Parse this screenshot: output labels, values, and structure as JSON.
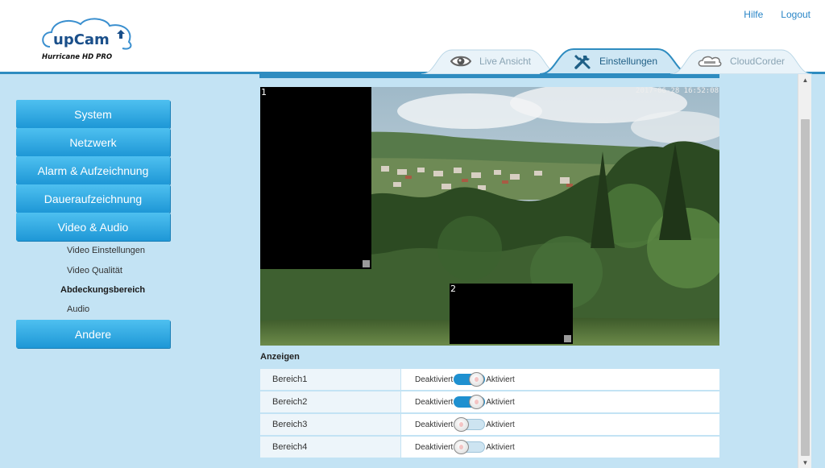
{
  "brand": {
    "logo_text": "upCam",
    "product_name": "Hurricane HD PRO"
  },
  "top_links": {
    "help": "Hilfe",
    "logout": "Logout"
  },
  "tabs": [
    {
      "label": "Live Ansicht",
      "icon": "eye-icon",
      "active": false
    },
    {
      "label": "Einstellungen",
      "icon": "tools-icon",
      "active": true
    },
    {
      "label": "CloudCorder",
      "icon": "cloud-icon",
      "active": false
    }
  ],
  "sidebar": {
    "items": [
      {
        "label": "System"
      },
      {
        "label": "Netzwerk"
      },
      {
        "label": "Alarm & Aufzeichnung"
      },
      {
        "label": "Daueraufzeichnung"
      },
      {
        "label": "Video & Audio"
      },
      {
        "label": "Andere"
      }
    ],
    "sub_items": [
      {
        "label": "Video Einstellungen",
        "selected": false
      },
      {
        "label": "Video Qualität",
        "selected": false
      },
      {
        "label": "Abdeckungsbereich",
        "selected": true
      },
      {
        "label": "Audio",
        "selected": false
      }
    ]
  },
  "video": {
    "timestamp": "2017-06-28 16:52:08",
    "masks": [
      {
        "number": "1"
      },
      {
        "number": "2"
      }
    ]
  },
  "anzeigen": {
    "title": "Anzeigen",
    "off_label": "Deaktiviert",
    "on_label": "Aktiviert",
    "rows": [
      {
        "label": "Bereich1",
        "enabled": true
      },
      {
        "label": "Bereich2",
        "enabled": true
      },
      {
        "label": "Bereich3",
        "enabled": false
      },
      {
        "label": "Bereich4",
        "enabled": false
      }
    ]
  },
  "colors": {
    "accent": "#2e8cc0",
    "nav_button": "#1e97d6",
    "background": "#c3e3f4",
    "link": "#2a86c7"
  }
}
